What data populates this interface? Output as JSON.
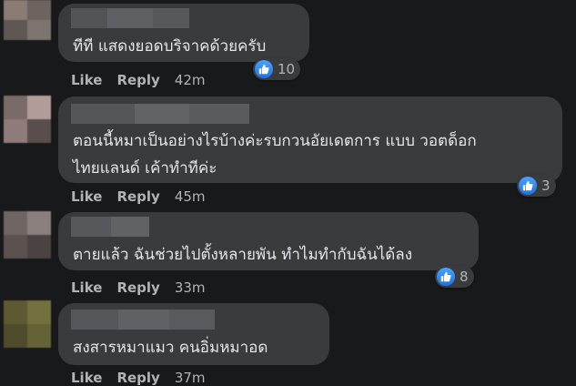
{
  "actions": {
    "like": "Like",
    "reply": "Reply"
  },
  "comments": [
    {
      "text_lines": [
        "ทีที แสดงยอดบริจาคด้วยครับ"
      ],
      "reactions": "10",
      "time": "42m"
    },
    {
      "text_lines": [
        "ตอนนี้หมาเป็นอย่างไรบ้างค่ะรบกวนอัยเดตการ แบบ วอตด็อก",
        "ไทยแลนด์ เค้าทำทีค่ะ"
      ],
      "reactions": "3",
      "time": "45m"
    },
    {
      "text_lines": [
        "ตายแล้ว ฉันช่วยไปตั้งหลายพัน ทำไมทำกับฉันได้ลง"
      ],
      "reactions": "8",
      "time": "33m"
    },
    {
      "text_lines": [
        "สงสารหมาแมว คนอิ่มหมาอด"
      ],
      "reactions": "",
      "time": "37m"
    }
  ],
  "colors": {
    "background": "#18191a",
    "bubble": "#3a3b3c",
    "like_blue": "#1a73e8"
  }
}
